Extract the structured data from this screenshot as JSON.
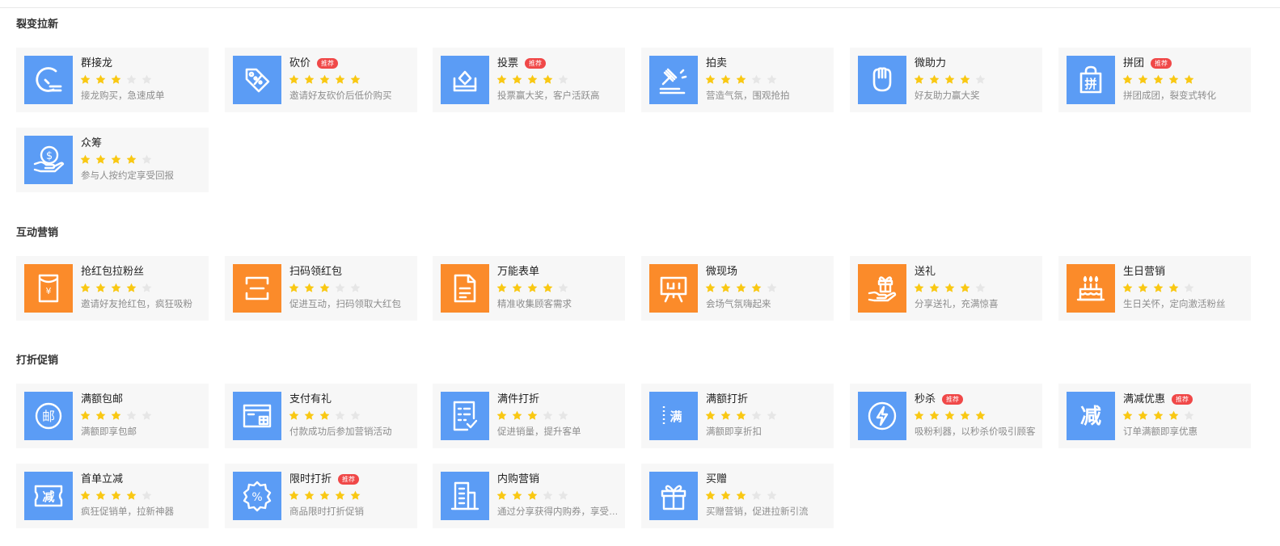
{
  "colors": {
    "blue": "#5b9cf5",
    "orange": "#fb8b2a",
    "star_on": "#f9c813",
    "star_off": "#e6e6e6",
    "badge": "#f04848"
  },
  "sections": [
    {
      "title": "裂变拉新",
      "cards": [
        {
          "icon": "solitaire-icon",
          "title": "群接龙",
          "badge": "",
          "stars": 3,
          "desc": "接龙购买，急速成单"
        },
        {
          "icon": "price-tag-icon",
          "title": "砍价",
          "badge": "推荐",
          "stars": 5,
          "desc": "邀请好友砍价后低价购买"
        },
        {
          "icon": "ballot-box-icon",
          "title": "投票",
          "badge": "推荐",
          "stars": 4,
          "desc": "投票赢大奖，客户活跃高"
        },
        {
          "icon": "auction-hammer-icon",
          "title": "拍卖",
          "badge": "",
          "stars": 3,
          "desc": "营造气氛，围观抢拍"
        },
        {
          "icon": "fist-icon",
          "title": "微助力",
          "badge": "",
          "stars": 4,
          "desc": "好友助力赢大奖"
        },
        {
          "icon": "group-buy-bag-icon",
          "title": "拼团",
          "badge": "推荐",
          "stars": 5,
          "desc": "拼团成团，裂变式转化"
        },
        {
          "icon": "crowdfunding-coin-hand-icon",
          "title": "众筹",
          "badge": "",
          "stars": 4,
          "desc": "参与人按约定享受回报"
        }
      ]
    },
    {
      "title": "互动营销",
      "cards": [
        {
          "icon": "red-envelope-icon",
          "title": "抢红包拉粉丝",
          "badge": "",
          "stars": 4,
          "desc": "邀请好友抢红包，疯狂吸粉"
        },
        {
          "icon": "scan-code-icon",
          "title": "扫码领红包",
          "badge": "",
          "stars": 3,
          "desc": "促进互动，扫码领取大红包"
        },
        {
          "icon": "form-document-icon",
          "title": "万能表单",
          "badge": "",
          "stars": 4,
          "desc": "精准收集顾客需求"
        },
        {
          "icon": "live-screen-icon",
          "title": "微现场",
          "badge": "",
          "stars": 4,
          "desc": "会场气氛嗨起来"
        },
        {
          "icon": "gift-hand-icon",
          "title": "送礼",
          "badge": "",
          "stars": 4,
          "desc": "分享送礼，充满惊喜"
        },
        {
          "icon": "birthday-cake-icon",
          "title": "生日营销",
          "badge": "",
          "stars": 4,
          "desc": "生日关怀，定向激活粉丝"
        }
      ]
    },
    {
      "title": "打折促销",
      "cards": [
        {
          "icon": "mail-stamp-icon",
          "title": "满额包邮",
          "badge": "",
          "stars": 3,
          "desc": "满额即享包邮"
        },
        {
          "icon": "payment-gift-icon",
          "title": "支付有礼",
          "badge": "",
          "stars": 3,
          "desc": "付款成功后参加营销活动"
        },
        {
          "icon": "checklist-icon",
          "title": "满件打折",
          "badge": "",
          "stars": 3,
          "desc": "促进销量，提升客单"
        },
        {
          "icon": "full-coupon-icon",
          "title": "满额打折",
          "badge": "",
          "stars": 3,
          "desc": "满额即享折扣"
        },
        {
          "icon": "lightning-icon",
          "title": "秒杀",
          "badge": "推荐",
          "stars": 5,
          "desc": "吸粉利器，以秒杀价吸引顾客"
        },
        {
          "icon": "reduce-char-icon",
          "title": "满减优惠",
          "badge": "推荐",
          "stars": 4,
          "desc": "订单满额即享优惠"
        },
        {
          "icon": "reduce-coupon-icon",
          "title": "首单立减",
          "badge": "",
          "stars": 4,
          "desc": "疯狂促销单，拉新神器"
        },
        {
          "icon": "percent-badge-icon",
          "title": "限时打折",
          "badge": "推荐",
          "stars": 5,
          "desc": "商品限时打折促销"
        },
        {
          "icon": "building-icon",
          "title": "内购营销",
          "badge": "",
          "stars": 3,
          "desc": "通过分享获得内购券，享受优惠"
        },
        {
          "icon": "gift-box-icon",
          "title": "买赠",
          "badge": "",
          "stars": 3,
          "desc": "买赠营销，促进拉新引流"
        }
      ]
    }
  ]
}
